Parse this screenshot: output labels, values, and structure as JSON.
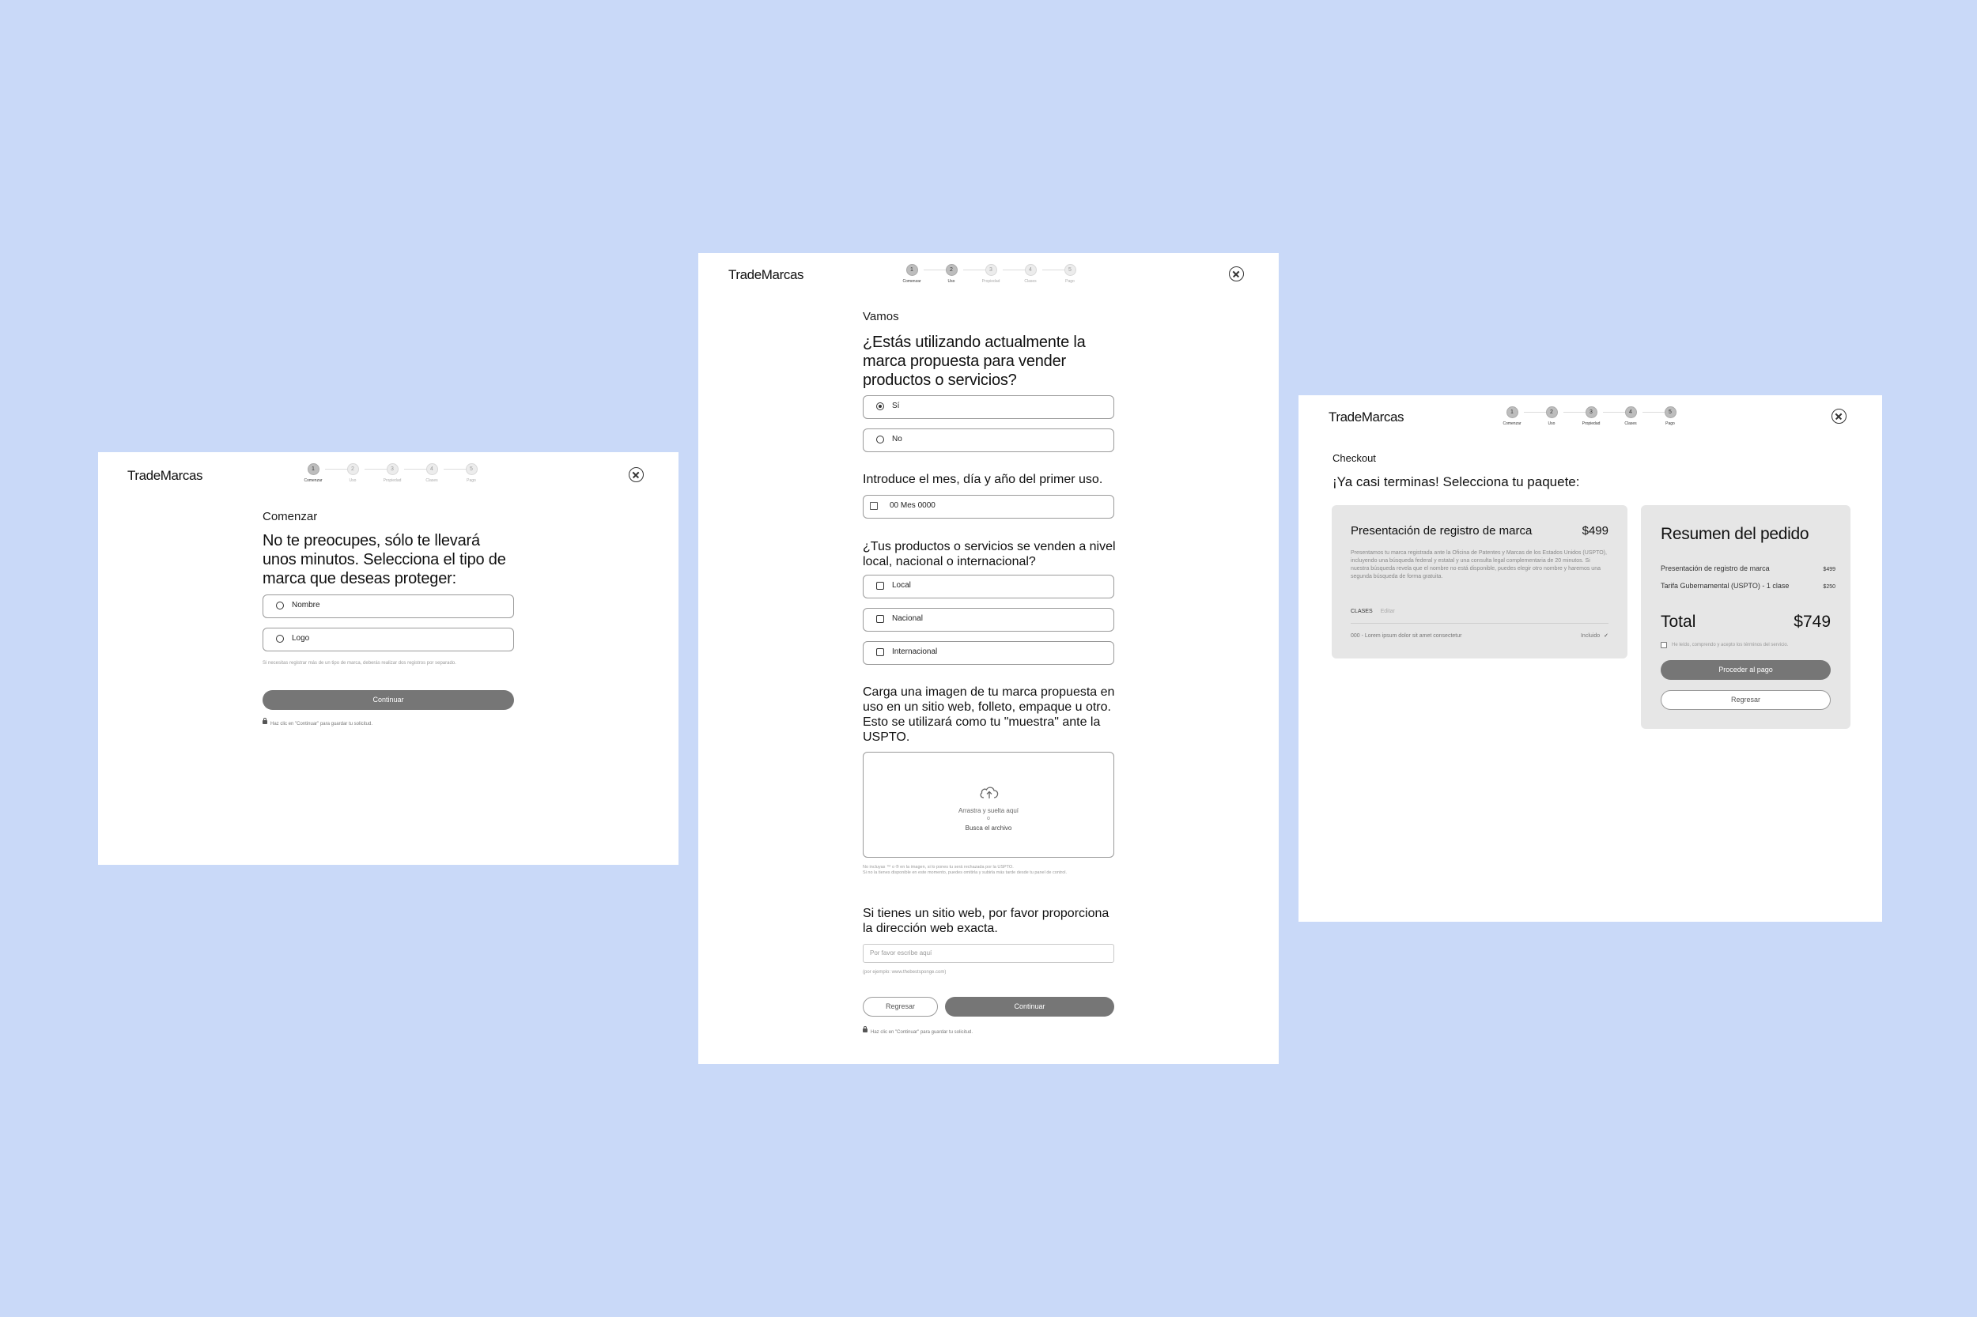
{
  "brand": "TradeMarcas",
  "steps": [
    {
      "num": "1",
      "label": "Comenzar"
    },
    {
      "num": "2",
      "label": "Uso"
    },
    {
      "num": "3",
      "label": "Propiedad"
    },
    {
      "num": "4",
      "label": "Clases"
    },
    {
      "num": "5",
      "label": "Pago"
    }
  ],
  "screen1": {
    "eyebrow": "Comenzar",
    "heading": "No te preocupes, sólo te llevará unos minutos. Selecciona el tipo de marca que deseas proteger:",
    "options": [
      "Nombre",
      "Logo"
    ],
    "note": "Si necesitas registrar más de un tipo de marca, deberás realizar dos registros por separado.",
    "continue_label": "Continuar",
    "save_note": "Haz clic en \"Continuar\" para guardar tu solicitud."
  },
  "screen2": {
    "eyebrow": "Vamos",
    "heading": "¿Estás utilizando actualmente la marca propuesta para vender productos o servicios?",
    "use_options": [
      "Sí",
      "No"
    ],
    "date_question": "Introduce el mes, día y año del primer uso.",
    "date_value": "00 Mes 0000",
    "scope_question": "¿Tus productos o servicios se venden a nivel local, nacional o internacional?",
    "scope_options": [
      "Local",
      "Nacional",
      "Internacional"
    ],
    "upload_question": "Carga una imagen de tu marca propuesta en uso en un sitio web, folleto, empaque u otro. Esto se utilizará como tu \"muestra\" ante la USPTO.",
    "upload_drag": "Arrastra y suelta aquí",
    "upload_or": "o",
    "upload_browse": "Busca el archivo",
    "upload_note_1": "No incluyas ™ o ® en la imagen, si lo pones tu será rechazada por la USPTO.",
    "upload_note_2": "Si no la tienes disponible en este momento, puedes omitirla y subirla más tarde desde tu panel de control.",
    "web_question": "Si tienes un sitio web, por favor proporciona la dirección web exacta.",
    "web_placeholder": "Por favor escribe aquí",
    "web_example": "(por ejemplo: www.thebestsponge.com)",
    "back_label": "Regresar",
    "continue_label": "Continuar",
    "save_note": "Haz clic en \"Continuar\" para guardar tu solicitud."
  },
  "screen3": {
    "eyebrow": "Checkout",
    "heading": "¡Ya casi terminas! Selecciona tu paquete:",
    "package": {
      "title": "Presentación de registro de marca",
      "price": "$499",
      "description": "Presentamos tu marca registrada ante la Oficina de Patentes y Marcas de los Estados Unidos (USPTO), incluyendo una búsqueda federal y estatal y una consulta legal complementaria de 20 minutos. Si nuestra búsqueda revela que el nombre no está disponible, puedes elegir otro nombre y haremos una segunda búsqueda de forma gratuita.",
      "classes_label": "CLASES",
      "edit_label": "Editar",
      "class_item": "000 - Lorem ipsum dolor sit amet consectetur",
      "included_label": "Incluido"
    },
    "summary": {
      "title": "Resumen del pedido",
      "lines": [
        {
          "label": "Presentación de registro de marca",
          "amount": "$499"
        },
        {
          "label": "Tarifa Gubernamental (USPTO) - 1 clase",
          "amount": "$250"
        }
      ],
      "total_label": "Total",
      "total_value": "$749",
      "terms": "He leído, comprendo y acepto los términos del servicio.",
      "pay_label": "Proceder al pago",
      "back_label": "Regresar"
    }
  },
  "colors": {
    "background": "#c9d9f8",
    "panel": "#ffffff",
    "button": "#767676",
    "card": "#e6e6e6"
  }
}
